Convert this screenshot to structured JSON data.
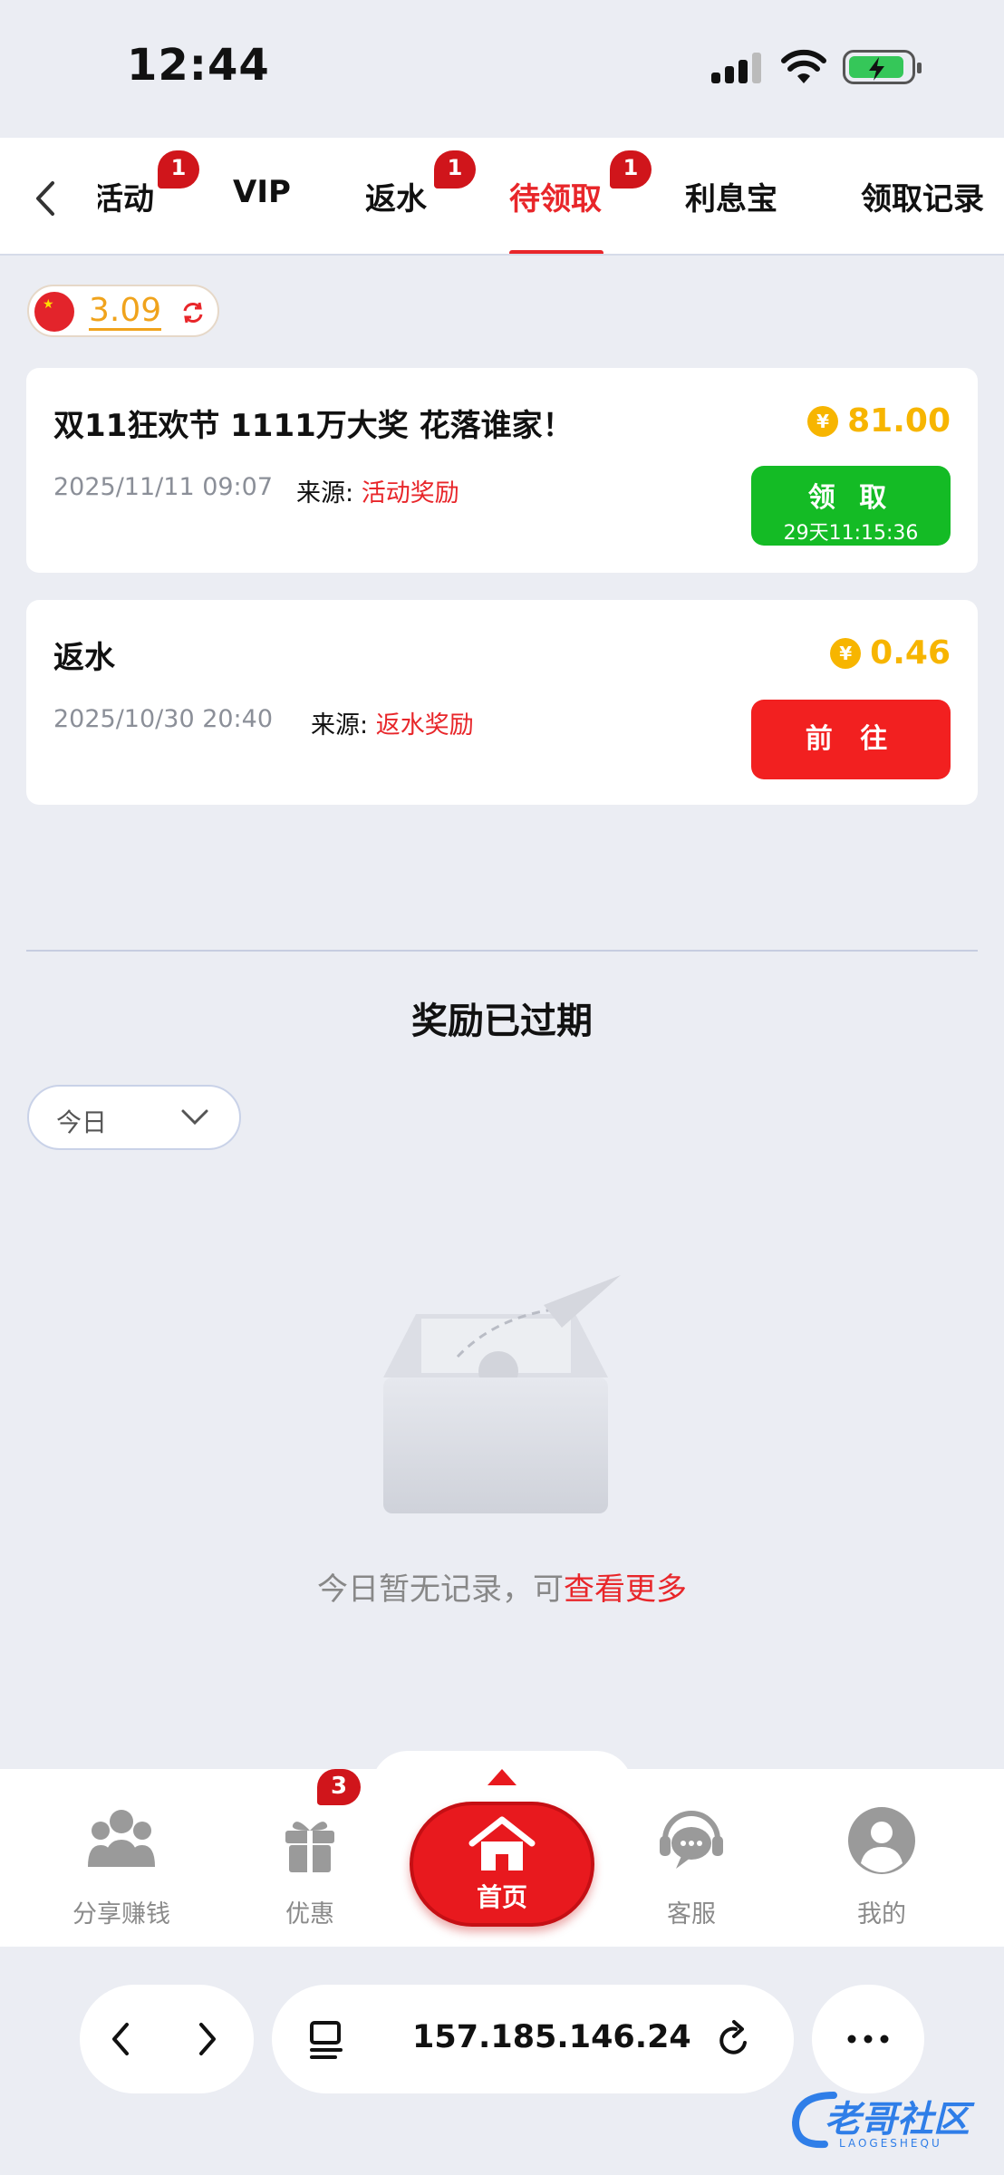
{
  "status_bar": {
    "time": "12:44"
  },
  "tabs": [
    {
      "label": "活动",
      "badge": "1"
    },
    {
      "label": "VIP",
      "badge": ""
    },
    {
      "label": "返水",
      "badge": "1"
    },
    {
      "label": "待领取",
      "badge": "1",
      "active": true
    },
    {
      "label": "利息宝",
      "badge": ""
    },
    {
      "label": "领取记录",
      "badge": ""
    }
  ],
  "balance": {
    "value": "3.09"
  },
  "rewards": [
    {
      "title": "双11狂欢节 1111万大奖 花落谁家！",
      "date": "2025/11/11 09:07",
      "source_label": "来源:",
      "source_value": "活动奖励",
      "amount": "81.00",
      "button_label": "领 取",
      "button_sub": "29天11:15:36"
    },
    {
      "title": "返水",
      "date": "2025/10/30 20:40",
      "source_label": "来源:",
      "source_value": "返水奖励",
      "amount": "0.46",
      "button_label": "前 往"
    }
  ],
  "expired": {
    "title": "奖励已过期",
    "filter": "今日",
    "empty_text": "今日暂无记录，可",
    "empty_link": "查看更多"
  },
  "bottom_nav": {
    "share": "分享赚钱",
    "promo": "优惠",
    "promo_badge": "3",
    "home": "首页",
    "service": "客服",
    "mine": "我的"
  },
  "browser": {
    "url": "157.185.146.24"
  },
  "watermark": {
    "main": "老哥社区",
    "sub": "LAOGESHEQU"
  },
  "colors": {
    "accent_red": "#e8262a",
    "claim_green": "#14bb25",
    "amount_gold": "#f7b500",
    "background": "#ebedf3"
  }
}
